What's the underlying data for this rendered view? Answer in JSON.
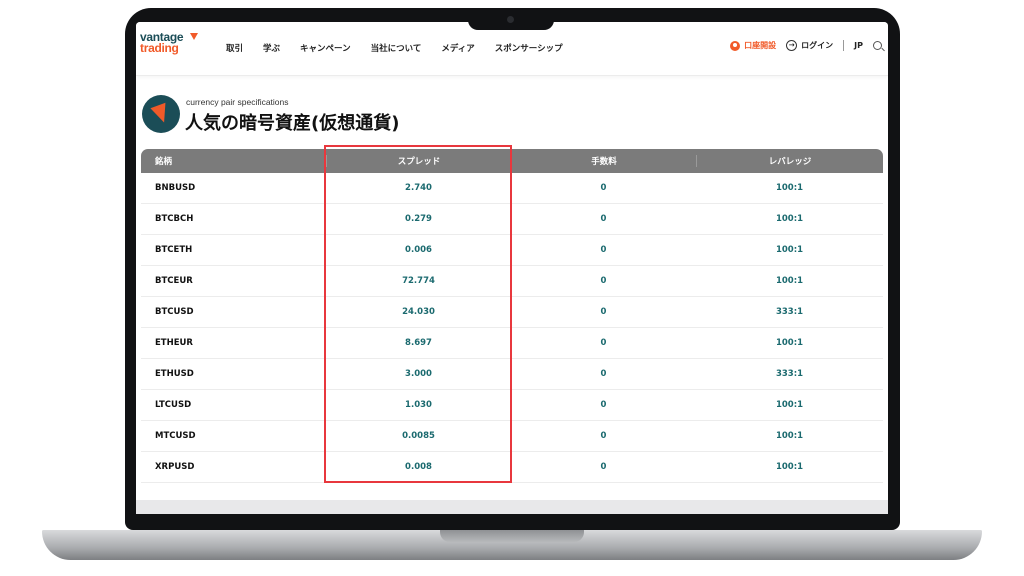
{
  "header": {
    "logo_top": "vantage",
    "logo_bottom": "trading",
    "nav": [
      "取引",
      "学ぶ",
      "キャンペーン",
      "当社について",
      "メディア",
      "スポンサーシップ"
    ],
    "open_account": "口座開設",
    "login": "ログイン",
    "language": "JP"
  },
  "page": {
    "subtitle": "currency pair specifications",
    "title": "人気の暗号資産(仮想通貨)"
  },
  "table": {
    "headers": [
      "銘柄",
      "スプレッド",
      "手数料",
      "レバレッジ"
    ],
    "rows": [
      [
        "BNBUSD",
        "2.740",
        "0",
        "100:1"
      ],
      [
        "BTCBCH",
        "0.279",
        "0",
        "100:1"
      ],
      [
        "BTCETH",
        "0.006",
        "0",
        "100:1"
      ],
      [
        "BTCEUR",
        "72.774",
        "0",
        "100:1"
      ],
      [
        "BTCUSD",
        "24.030",
        "0",
        "333:1"
      ],
      [
        "ETHEUR",
        "8.697",
        "0",
        "100:1"
      ],
      [
        "ETHUSD",
        "3.000",
        "0",
        "333:1"
      ],
      [
        "LTCUSD",
        "1.030",
        "0",
        "100:1"
      ],
      [
        "MTCUSD",
        "0.0085",
        "0",
        "100:1"
      ],
      [
        "XRPUSD",
        "0.008",
        "0",
        "100:1"
      ]
    ]
  },
  "colors": {
    "accent": "#f15a29",
    "brand": "#1b4d57",
    "value_text": "#1b6a6f",
    "highlight": "#e8373d"
  }
}
